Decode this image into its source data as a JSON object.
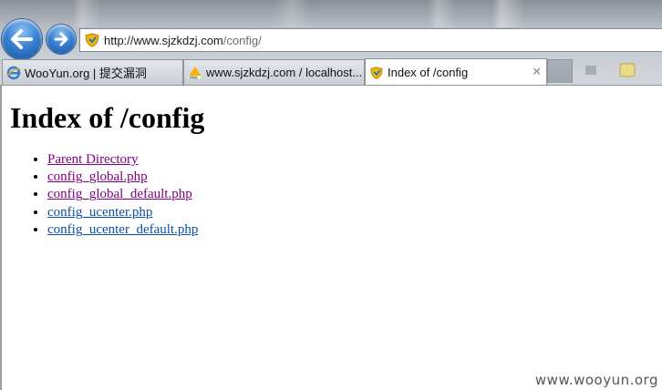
{
  "browser": {
    "address_url_main": "http://www.sjzkdzj.com",
    "address_url_path": "/config/",
    "tabs": [
      {
        "label": "WooYun.org | 提交漏洞",
        "icon": "ie-favicon",
        "active": false
      },
      {
        "label": "www.sjzkdzj.com / localhost...",
        "icon": "phpmyadmin-favicon",
        "active": false
      },
      {
        "label": "Index of /config",
        "icon": "shield-favicon",
        "active": true
      }
    ],
    "close_glyph": "✕"
  },
  "page": {
    "title": "Index of /config",
    "links": [
      {
        "label": "Parent Directory",
        "visited": true
      },
      {
        "label": "config_global.php",
        "visited": true
      },
      {
        "label": "config_global_default.php",
        "visited": true
      },
      {
        "label": "config_ucenter.php",
        "visited": false
      },
      {
        "label": "config_ucenter_default.php",
        "visited": false
      }
    ]
  },
  "watermark": "www.wooyun.org",
  "colors": {
    "visited_link": "#800080",
    "unvisited_link": "#0a4fa8",
    "nav_button": "#3a82d2"
  }
}
